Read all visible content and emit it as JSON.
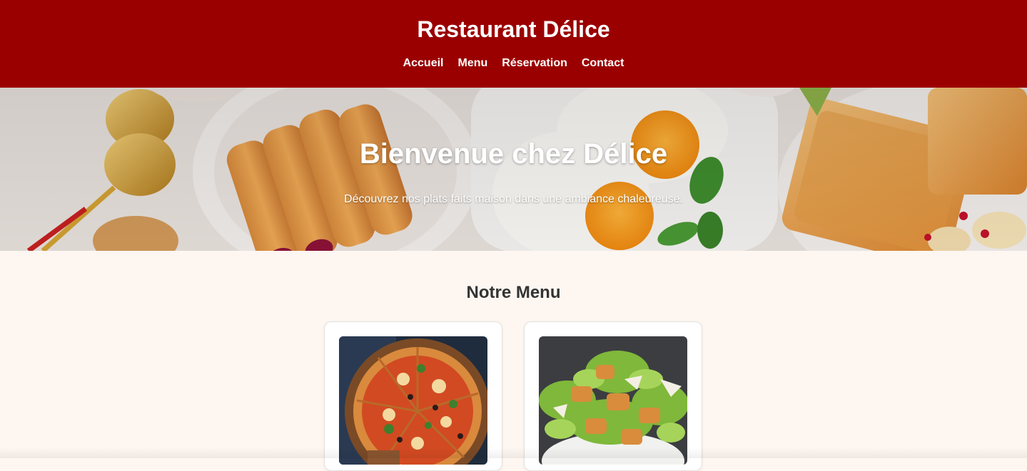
{
  "header": {
    "title": "Restaurant Délice",
    "nav": [
      {
        "label": "Accueil"
      },
      {
        "label": "Menu"
      },
      {
        "label": "Réservation"
      },
      {
        "label": "Contact"
      }
    ]
  },
  "hero": {
    "title": "Bienvenue chez Délice",
    "subtitle": "Découvrez nos plats faits maison dans une ambiance chaleureuse."
  },
  "menu": {
    "title": "Notre Menu",
    "items": [
      {
        "image": "pizza-photo"
      },
      {
        "image": "caesar-salad-photo"
      }
    ]
  },
  "colors": {
    "header_bg": "#9b0000",
    "page_bg": "#fdf6f1",
    "text_light": "#ffffff",
    "text_dark": "#333333"
  }
}
